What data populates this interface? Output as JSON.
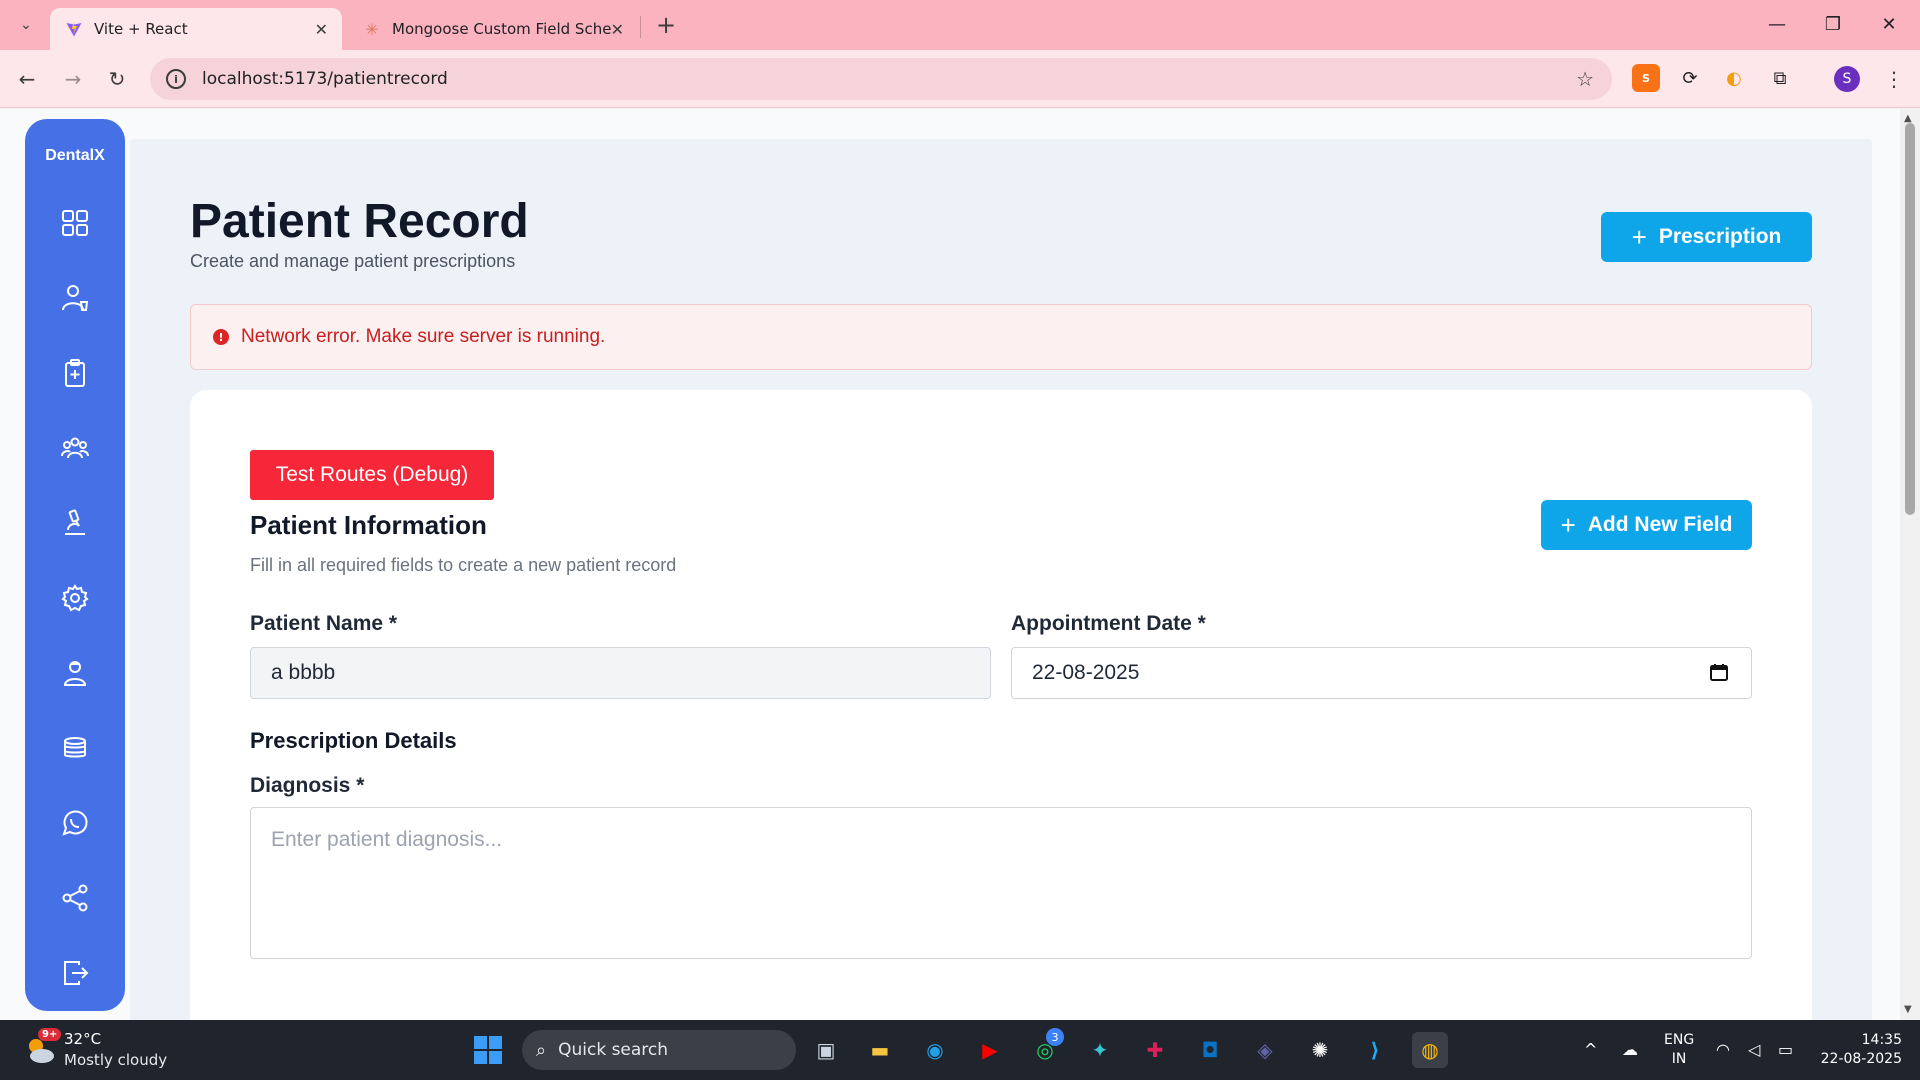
{
  "browser": {
    "tabs": [
      {
        "title": "Vite + React",
        "active": true
      },
      {
        "title": "Mongoose Custom Field Schem",
        "active": false
      }
    ],
    "url": "localhost:5173/patientrecord"
  },
  "sidebar": {
    "brand": "DentalX",
    "items": [
      "dashboard",
      "doctor",
      "clipboard",
      "group",
      "microscope",
      "settings",
      "user",
      "stack",
      "whatsapp",
      "share",
      "logout"
    ]
  },
  "header": {
    "title": "Patient Record",
    "subtitle": "Create and manage patient prescriptions",
    "prescription_button": "Prescription"
  },
  "alert": {
    "message": "Network error. Make sure server is running."
  },
  "form": {
    "debug_button": "Test Routes (Debug)",
    "section_title": "Patient Information",
    "section_subtitle": "Fill in all required fields to create a new patient record",
    "add_field_button": "Add New Field",
    "patient_name_label": "Patient Name *",
    "patient_name_value": "a bbbb",
    "appointment_date_label": "Appointment Date *",
    "appointment_date_value": "22-08-2025",
    "prescription_details_title": "Prescription Details",
    "diagnosis_label": "Diagnosis *",
    "diagnosis_placeholder": "Enter patient diagnosis..."
  },
  "taskbar": {
    "weather_temp": "32°C",
    "weather_desc": "Mostly cloudy",
    "weather_badge": "9+",
    "search_label": "Quick search",
    "whatsapp_badge": "3",
    "lang_line1": "ENG",
    "lang_line2": "IN",
    "time": "14:35",
    "date": "22-08-2025"
  },
  "colors": {
    "sidebar": "#4671e6",
    "accent": "#0ea5e9",
    "debug": "#f52738",
    "error": "#c81e1e",
    "tab_strip": "#fbb3c0"
  }
}
